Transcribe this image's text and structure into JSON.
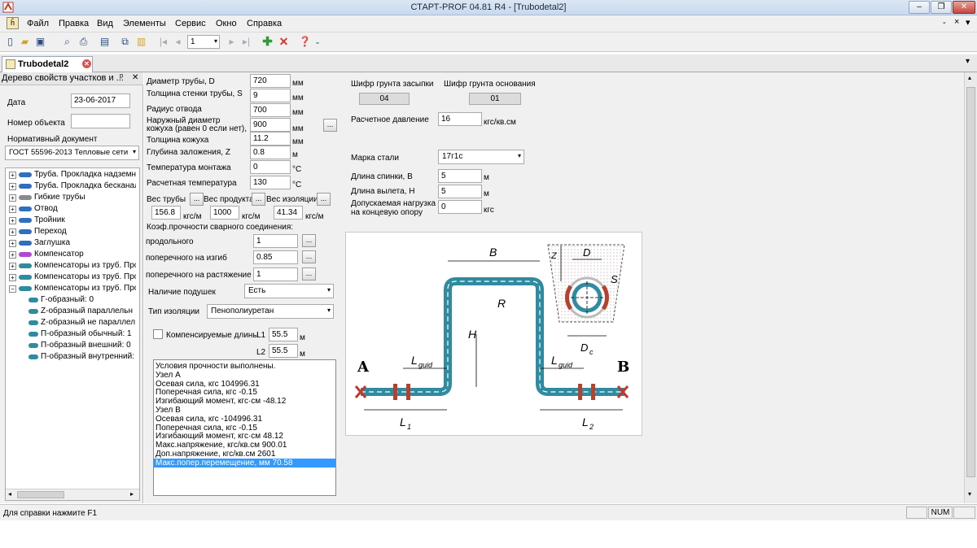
{
  "window": {
    "title": "СТАРТ-PROF 04.81 R4 - [Trubodetal2]",
    "min_glyph": "–",
    "restore_glyph": "❐",
    "close_glyph": "✕",
    "mdi_min": "-",
    "mdi_close": "×",
    "mdi_pin": "▾"
  },
  "menu": [
    {
      "label": "Файл"
    },
    {
      "label": "Правка"
    },
    {
      "label": "Вид"
    },
    {
      "label": "Элементы"
    },
    {
      "label": "Сервис"
    },
    {
      "label": "Окно"
    },
    {
      "label": "Справка"
    }
  ],
  "toolbar": {
    "page_value": "1",
    "more_glyph": "⌄"
  },
  "tab": {
    "label": "Trubodetal2",
    "close_glyph": "✕",
    "menu_glyph": "▾"
  },
  "left": {
    "header": "Дерево свойств участков и ...",
    "header_pin": "ᵖ",
    "header_close": "✕",
    "date_label": "Дата",
    "date_value": "23-06-2017",
    "object_label": "Номер объекта",
    "object_value": "",
    "norm_label": "Нормативный документ",
    "norm_value": "ГОСТ 55596-2013 Тепловые сети",
    "tree": [
      {
        "label": "Труба. Прокладка надземна",
        "exp": "+",
        "icon": "pipe-icon"
      },
      {
        "label": "Труба. Прокладка бесканал",
        "exp": "+",
        "icon": "pipe-icon"
      },
      {
        "label": "Гибкие трубы",
        "exp": "+",
        "icon": "flex-pipe-icon"
      },
      {
        "label": "Отвод",
        "exp": "+",
        "icon": "elbow-icon"
      },
      {
        "label": "Тройник",
        "exp": "+",
        "icon": "tee-icon"
      },
      {
        "label": "Переход",
        "exp": "+",
        "icon": "reducer-icon"
      },
      {
        "label": "Заглушка",
        "exp": "+",
        "icon": "plug-icon"
      },
      {
        "label": "Компенсатор",
        "exp": "+",
        "icon": "compensator-icon"
      },
      {
        "label": "Компенсаторы из труб. Прок",
        "exp": "+",
        "icon": "pipe-bend-icon"
      },
      {
        "label": "Компенсаторы из труб. Прок",
        "exp": "+",
        "icon": "pipe-bend-icon"
      },
      {
        "label": "Компенсаторы из труб. Прок",
        "exp": "−",
        "icon": "pipe-bend-icon"
      },
      {
        "label": "Г-образный: 0",
        "exp": "",
        "icon": "l-shape-icon"
      },
      {
        "label": "Z-образный параллельн",
        "exp": "",
        "icon": "z-shape-icon"
      },
      {
        "label": "Z-образный не параллел",
        "exp": "",
        "icon": "z-shape-icon"
      },
      {
        "label": "П-образный обычный: 1",
        "exp": "",
        "icon": "u-shape-icon"
      },
      {
        "label": "П-образный внешний: 0",
        "exp": "",
        "icon": "u-shape-icon"
      },
      {
        "label": "П-образный внутренний:",
        "exp": "",
        "icon": "u-shape-icon"
      }
    ]
  },
  "form": {
    "diam_label": "Диаметр трубы, D",
    "diam_value": "720",
    "diam_unit": "мм",
    "wall_label": "Толщина стенки трубы, S",
    "wall_value": "9",
    "wall_unit": "мм",
    "radius_label": "Радиус отвода",
    "radius_value": "700",
    "radius_unit": "мм",
    "casing_label_1": "Наружный диаметр",
    "casing_label_2": "кожуха (равен 0 если нет),",
    "casing_value": "900",
    "casing_unit": "мм",
    "casing_thk_label": "Толщина кожуха",
    "casing_thk_value": "11.2",
    "casing_thk_unit": "мм",
    "depth_label": "Глубина заложения, Z",
    "depth_value": "0.8",
    "depth_unit": "м",
    "tmont_label": "Температура монтажа",
    "tmont_value": "0",
    "tmont_unit": "°С",
    "tcalc_label": "Расчетная температура",
    "tcalc_value": "130",
    "tcalc_unit": "°С",
    "w_pipe_label": "Вес трубы",
    "w_prod_label": "Вес продукта",
    "w_ins_label": "Вес изоляции",
    "w_pipe_value": "156.8",
    "w_prod_value": "1000",
    "w_ins_value": "41.34",
    "w_unit": "кгс/м",
    "weld_title": "Коэф.прочности сварного соединения:",
    "weld_long_label": "продольного",
    "weld_long_value": "1",
    "weld_bend_label": "поперечного на изгиб",
    "weld_bend_value": "0.85",
    "weld_tens_label": "поперечного на растяжение",
    "weld_tens_value": "1",
    "pads_label": "Наличие подушек",
    "pads_value": "Есть",
    "ins_type_label": "Тип изоляции",
    "ins_type_value": "Пенополиуретан",
    "comp_len_label": "Компенсируемые длины",
    "l1_label": "L1",
    "l1_value": "55.5",
    "l2_label": "L2",
    "l2_value": "55.5",
    "len_unit": "м",
    "soil_fill_label": "Шифр грунта засыпки",
    "soil_fill_value": "04",
    "soil_base_label": "Шифр грунта основания",
    "soil_base_value": "01",
    "press_label": "Расчетное давление",
    "press_value": "16",
    "press_unit": "кгс/кв.см",
    "steel_label": "Марка стали",
    "steel_value": "17г1с",
    "back_label": "Длина спинки, B",
    "back_value": "5",
    "back_unit": "м",
    "reach_label": "Длина вылета, H",
    "reach_value": "5",
    "reach_unit": "м",
    "allow_label_1": "Допускаемая нагрузка",
    "allow_label_2": "на концевую опору",
    "allow_value": "0",
    "allow_unit": "кгс",
    "btn_glyph": "..."
  },
  "results": [
    "Условия прочности выполнены.",
    "Узел A",
    "Осевая сила, кгс  104996.31",
    "Поперечная сила, кгс  -0.15",
    "Изгибающий момент, кгс·см  -48.12",
    "Узел B",
    "Осевая сила, кгс  -104996.31",
    "Поперечная сила, кгс  -0.15",
    "Изгибающий момент, кгс·см  48.12",
    "Макс.напряжение, кгс/кв.см  900.01",
    "Доп.напряжение, кгс/кв.см  2601",
    "Макс.попер.перемещение, мм  70.58"
  ],
  "diagram": {
    "A": "A",
    "B": "B",
    "Bdim": "B",
    "H": "H",
    "R": "R",
    "D": "D",
    "S": "S",
    "Z": "Z",
    "Dc": "D",
    "Dc_sub": "c",
    "Lguid": "L",
    "Lguid_sub": "guid",
    "L1": "L",
    "L1_sub": "1",
    "L2": "L",
    "L2_sub": "2",
    "pipe_color": "#2f8ca0",
    "support_color": "#c0392b"
  },
  "status": {
    "help": "Для справки нажмите F1",
    "num": "NUM"
  }
}
